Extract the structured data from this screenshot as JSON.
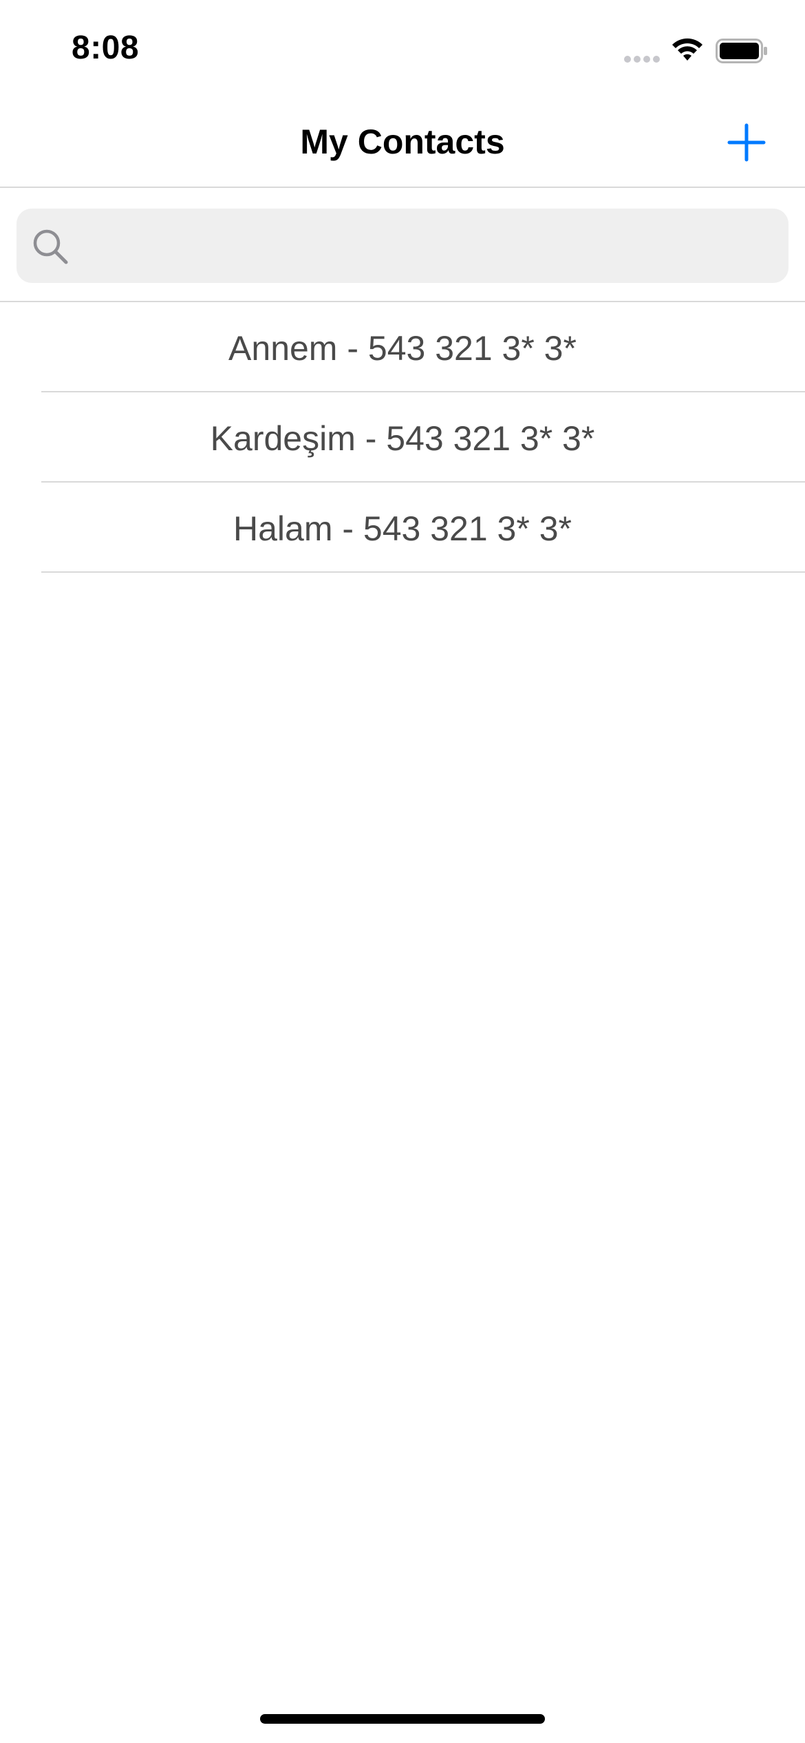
{
  "status_bar": {
    "time": "8:08"
  },
  "nav": {
    "title": "My Contacts",
    "add_icon": "plus-icon",
    "accent_color": "#007AFF"
  },
  "search": {
    "placeholder": "",
    "value": "",
    "icon": "search-icon"
  },
  "contacts": [
    {
      "label": "Annem - 543 321 3* 3*"
    },
    {
      "label": "Kardeşim - 543 321 3* 3*"
    },
    {
      "label": "Halam - 543 321 3* 3*"
    }
  ]
}
